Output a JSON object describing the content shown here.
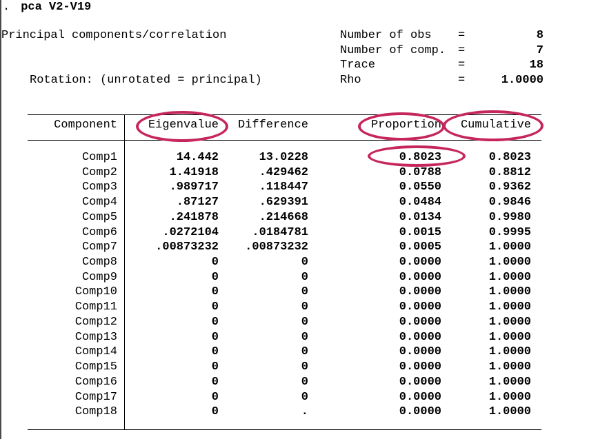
{
  "command": {
    "prompt": ".",
    "text": "pca V2-V19"
  },
  "header": {
    "title": "Principal components/correlation",
    "rotation_label": "Rotation: (unrotated = principal)",
    "stats": [
      {
        "label": "Number of obs",
        "eq": "=",
        "value": "8"
      },
      {
        "label": "Number of comp.",
        "eq": "=",
        "value": "7"
      },
      {
        "label": "Trace",
        "eq": "=",
        "value": "18"
      },
      {
        "label": "Rho",
        "eq": "=",
        "value": "1.0000"
      }
    ]
  },
  "table": {
    "columns": [
      "Component",
      "Eigenvalue",
      "Difference",
      "Proportion",
      "Cumulative"
    ],
    "rows": [
      {
        "component": "Comp1",
        "eigenvalue": "14.442",
        "difference": "13.0228",
        "proportion": "0.8023",
        "cumulative": "0.8023"
      },
      {
        "component": "Comp2",
        "eigenvalue": "1.41918",
        "difference": ".429462",
        "proportion": "0.0788",
        "cumulative": "0.8812"
      },
      {
        "component": "Comp3",
        "eigenvalue": ".989717",
        "difference": ".118447",
        "proportion": "0.0550",
        "cumulative": "0.9362"
      },
      {
        "component": "Comp4",
        "eigenvalue": ".87127",
        "difference": ".629391",
        "proportion": "0.0484",
        "cumulative": "0.9846"
      },
      {
        "component": "Comp5",
        "eigenvalue": ".241878",
        "difference": ".214668",
        "proportion": "0.0134",
        "cumulative": "0.9980"
      },
      {
        "component": "Comp6",
        "eigenvalue": ".0272104",
        "difference": ".0184781",
        "proportion": "0.0015",
        "cumulative": "0.9995"
      },
      {
        "component": "Comp7",
        "eigenvalue": ".00873232",
        "difference": ".00873232",
        "proportion": "0.0005",
        "cumulative": "1.0000"
      },
      {
        "component": "Comp8",
        "eigenvalue": "0",
        "difference": "0",
        "proportion": "0.0000",
        "cumulative": "1.0000"
      },
      {
        "component": "Comp9",
        "eigenvalue": "0",
        "difference": "0",
        "proportion": "0.0000",
        "cumulative": "1.0000"
      },
      {
        "component": "Comp10",
        "eigenvalue": "0",
        "difference": "0",
        "proportion": "0.0000",
        "cumulative": "1.0000"
      },
      {
        "component": "Comp11",
        "eigenvalue": "0",
        "difference": "0",
        "proportion": "0.0000",
        "cumulative": "1.0000"
      },
      {
        "component": "Comp12",
        "eigenvalue": "0",
        "difference": "0",
        "proportion": "0.0000",
        "cumulative": "1.0000"
      },
      {
        "component": "Comp13",
        "eigenvalue": "0",
        "difference": "0",
        "proportion": "0.0000",
        "cumulative": "1.0000"
      },
      {
        "component": "Comp14",
        "eigenvalue": "0",
        "difference": "0",
        "proportion": "0.0000",
        "cumulative": "1.0000"
      },
      {
        "component": "Comp15",
        "eigenvalue": "0",
        "difference": "0",
        "proportion": "0.0000",
        "cumulative": "1.0000"
      },
      {
        "component": "Comp16",
        "eigenvalue": "0",
        "difference": "0",
        "proportion": "0.0000",
        "cumulative": "1.0000"
      },
      {
        "component": "Comp17",
        "eigenvalue": "0",
        "difference": "0",
        "proportion": "0.0000",
        "cumulative": "1.0000"
      },
      {
        "component": "Comp18",
        "eigenvalue": "0",
        "difference": ".",
        "proportion": "0.0000",
        "cumulative": "1.0000"
      }
    ]
  },
  "annotations": {
    "highlight_color": "#c5275a",
    "circled_items": [
      "Eigenvalue",
      "Proportion",
      "Cumulative",
      "0.8023"
    ]
  }
}
